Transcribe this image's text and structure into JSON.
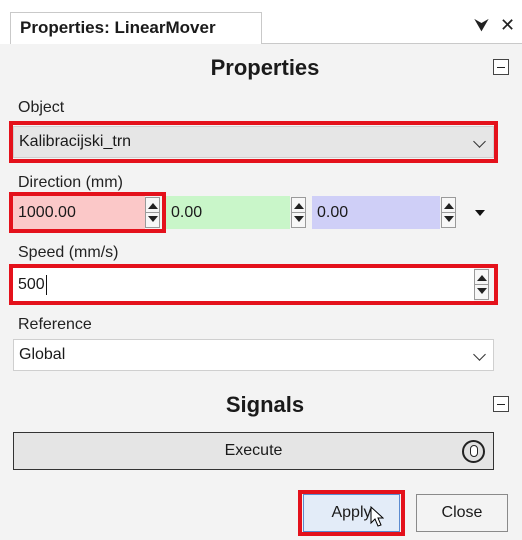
{
  "window": {
    "tab_title": "Properties: LinearMover",
    "pin_glyph": "⮟",
    "close_glyph": "✕"
  },
  "properties": {
    "header": "Properties",
    "object": {
      "label": "Object",
      "value": "Kalibracijski_trn"
    },
    "direction": {
      "label": "Direction (mm)",
      "x": "1000.00",
      "y": "0.00",
      "z": "0.00"
    },
    "speed": {
      "label": "Speed (mm/s)",
      "value": "500"
    },
    "reference": {
      "label": "Reference",
      "value": "Global"
    }
  },
  "signals": {
    "header": "Signals",
    "execute_label": "Execute"
  },
  "footer": {
    "apply_label": "Apply",
    "close_label": "Close"
  },
  "colors": {
    "highlight": "#e4111b",
    "x_field": "#fbc8c8",
    "y_field": "#c9f6c9",
    "z_field": "#cfcff7"
  }
}
